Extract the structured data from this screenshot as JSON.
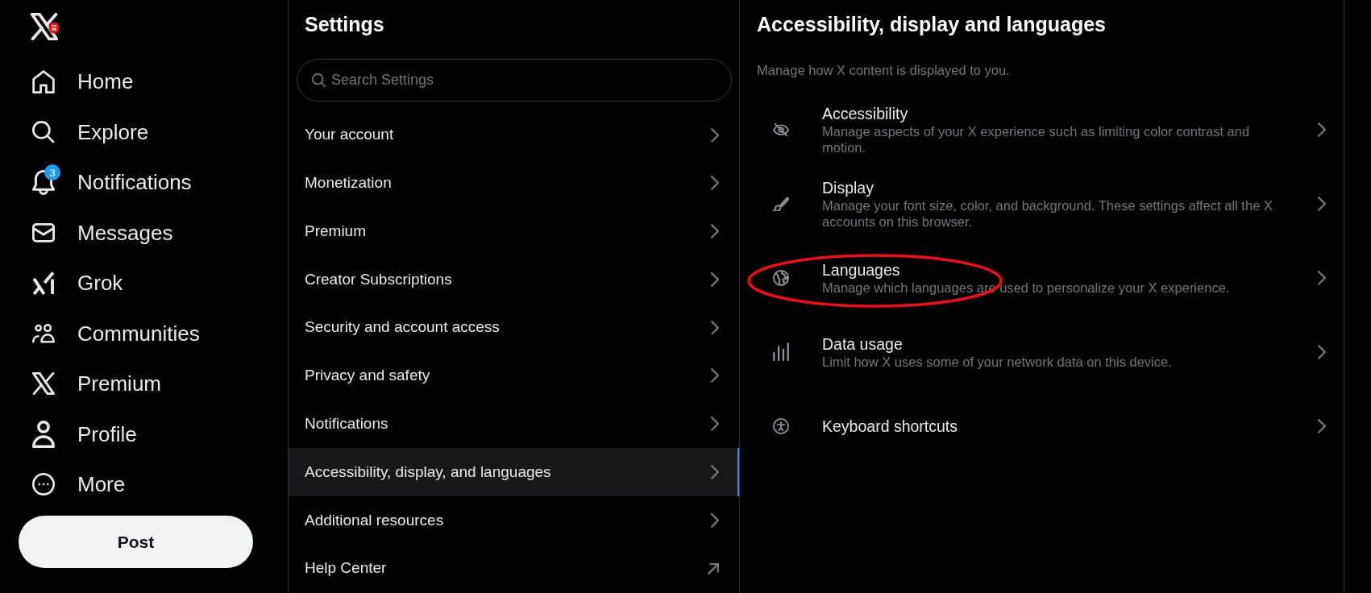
{
  "sidebar": {
    "nav_items": [
      {
        "label": "Home"
      },
      {
        "label": "Explore"
      },
      {
        "label": "Notifications",
        "badge": "3"
      },
      {
        "label": "Messages"
      },
      {
        "label": "Grok"
      },
      {
        "label": "Communities"
      },
      {
        "label": "Premium"
      },
      {
        "label": "Profile"
      },
      {
        "label": "More"
      }
    ],
    "post_button": "Post"
  },
  "settings": {
    "title": "Settings",
    "search": {
      "placeholder": "Search Settings"
    },
    "items": [
      {
        "label": "Your account",
        "kind": "page",
        "selected": false
      },
      {
        "label": "Monetization",
        "kind": "page",
        "selected": false
      },
      {
        "label": "Premium",
        "kind": "page",
        "selected": false
      },
      {
        "label": "Creator Subscriptions",
        "kind": "page",
        "selected": false
      },
      {
        "label": "Security and account access",
        "kind": "page",
        "selected": false
      },
      {
        "label": "Privacy and safety",
        "kind": "page",
        "selected": false
      },
      {
        "label": "Notifications",
        "kind": "page",
        "selected": false
      },
      {
        "label": "Accessibility, display, and languages",
        "kind": "page",
        "selected": true
      },
      {
        "label": "Additional resources",
        "kind": "page",
        "selected": false
      },
      {
        "label": "Help Center",
        "kind": "external",
        "selected": false
      }
    ]
  },
  "detail": {
    "title": "Accessibility, display and languages",
    "subtitle": "Manage how X content is displayed to you.",
    "items": [
      {
        "title": "Accessibility",
        "description": "Manage aspects of your X experience such as limiting color contrast and motion.",
        "circled": false
      },
      {
        "title": "Display",
        "description": "Manage your font size, color, and background. These settings affect all the X accounts on this browser.",
        "circled": false
      },
      {
        "title": "Languages",
        "description": "Manage which languages are used to personalize your X experience.",
        "circled": true
      },
      {
        "title": "Data usage",
        "description": "Limit how X uses some of your network data on this device.",
        "circled": false
      },
      {
        "title": "Keyboard shortcuts",
        "circled": false
      }
    ]
  }
}
